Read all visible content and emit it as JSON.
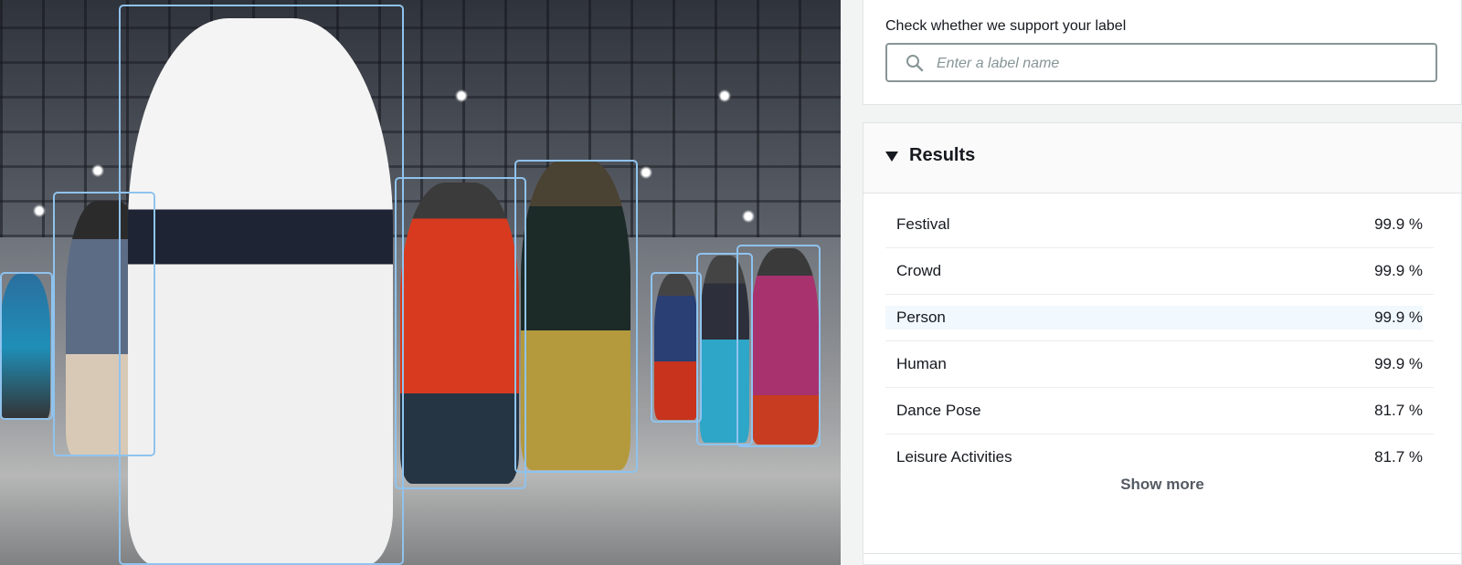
{
  "search": {
    "label": "Check whether we support your label",
    "placeholder": "Enter a label name",
    "icon": "search-icon"
  },
  "results": {
    "title": "Results",
    "items": [
      {
        "name": "Festival",
        "value": "99.9 %"
      },
      {
        "name": "Crowd",
        "value": "99.9 %"
      },
      {
        "name": "Person",
        "value": "99.9 %"
      },
      {
        "name": "Human",
        "value": "99.9 %"
      },
      {
        "name": "Dance Pose",
        "value": "81.7 %"
      },
      {
        "name": "Leisure Activities",
        "value": "81.7 %"
      }
    ],
    "show_more": "Show more"
  },
  "colors": {
    "bounding_box": "#8fc3ee",
    "text": "#16191f",
    "border": "#879596",
    "hover_row": "#f1f8fe"
  }
}
